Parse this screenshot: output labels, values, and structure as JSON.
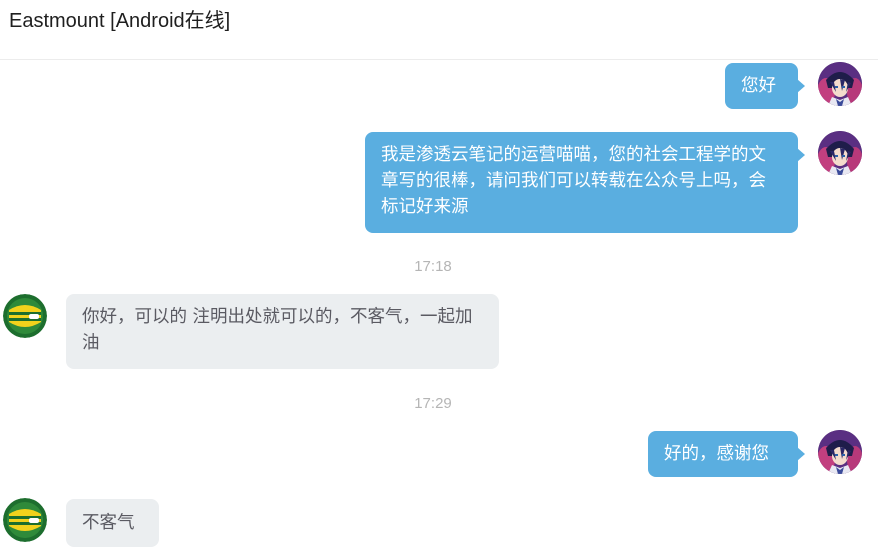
{
  "header": {
    "title": "Eastmount [Android在线]"
  },
  "colors": {
    "me_bubble": "#5aaee0",
    "other_bubble": "#ebeef0",
    "timestamp": "#b5b5b5"
  },
  "messages": [
    {
      "from": "me",
      "text": "您好",
      "avatar": "anime-avatar-icon"
    },
    {
      "from": "me",
      "text": "我是渗透云笔记的运营喵喵，您的社会工程学的文章写的很棒，请问我们可以转载在公众号上吗，会标记好来源",
      "avatar": "anime-avatar-icon"
    },
    {
      "timestamp": "17:18"
    },
    {
      "from": "other",
      "text": "你好，可以的 注明出处就可以的，不客气，一起加油",
      "avatar": "green-yellow-logo-icon"
    },
    {
      "timestamp": "17:29"
    },
    {
      "from": "me",
      "text": "好的，感谢您",
      "avatar": "anime-avatar-icon"
    },
    {
      "from": "other",
      "text": "不客气",
      "avatar": "green-yellow-logo-icon"
    }
  ]
}
